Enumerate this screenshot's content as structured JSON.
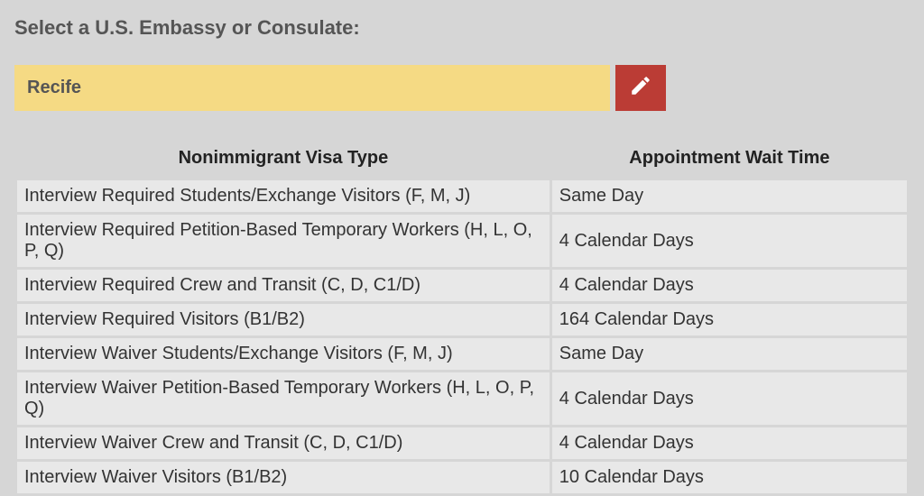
{
  "heading": "Select a U.S. Embassy or Consulate:",
  "selected_location": "Recife",
  "columns": {
    "visa_type": "Nonimmigrant Visa Type",
    "wait_time": "Appointment Wait Time"
  },
  "rows": [
    {
      "visa_type": "Interview Required Students/Exchange Visitors (F, M, J)",
      "wait_time": "Same Day"
    },
    {
      "visa_type": "Interview Required Petition-Based Temporary Workers (H, L, O, P, Q)",
      "wait_time": "4 Calendar Days"
    },
    {
      "visa_type": "Interview Required Crew and Transit (C, D, C1/D)",
      "wait_time": "4 Calendar Days"
    },
    {
      "visa_type": "Interview Required Visitors (B1/B2)",
      "wait_time": "164 Calendar Days"
    },
    {
      "visa_type": "Interview Waiver Students/Exchange Visitors (F, M, J)",
      "wait_time": "Same Day"
    },
    {
      "visa_type": "Interview Waiver Petition-Based Temporary Workers (H, L, O, P, Q)",
      "wait_time": "4 Calendar Days"
    },
    {
      "visa_type": "Interview Waiver Crew and Transit (C, D, C1/D)",
      "wait_time": "4 Calendar Days"
    },
    {
      "visa_type": "Interview Waiver Visitors (B1/B2)",
      "wait_time": "10 Calendar Days"
    }
  ]
}
